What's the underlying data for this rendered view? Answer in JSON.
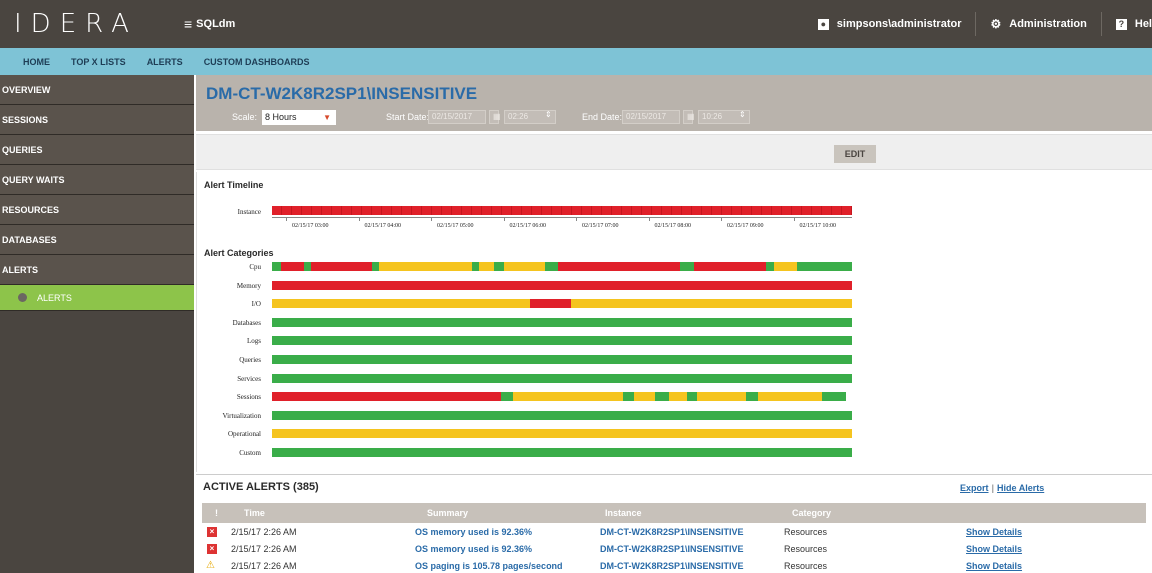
{
  "app": {
    "logo": "IDERA",
    "menu_icon": "≡",
    "name": "SQLdm"
  },
  "topbar": {
    "user": "simpsons\\administrator",
    "admin": "Administration",
    "help": "Hel"
  },
  "nav": [
    "HOME",
    "TOP X LISTS",
    "ALERTS",
    "CUSTOM DASHBOARDS"
  ],
  "sidebar": {
    "items": [
      "OVERVIEW",
      "SESSIONS",
      "QUERIES",
      "QUERY WAITS",
      "RESOURCES",
      "DATABASES",
      "ALERTS"
    ],
    "sub_item": "ALERTS"
  },
  "header": {
    "instance": "DM-CT-W2K8R2SP1\\INSENSITIVE",
    "scale_label": "Scale:",
    "scale_value": "8 Hours",
    "start_label": "Start Date:",
    "start_date": "02/15/2017",
    "start_time": "02:26",
    "end_label": "End Date:",
    "end_date": "02/15/2017",
    "end_time": "10:26"
  },
  "edit_label": "EDIT",
  "timeline": {
    "title": "Alert Timeline",
    "row_label": "Instance",
    "ticks": [
      "02/15/17 03:00",
      "02/15/17 04:00",
      "02/15/17 05:00",
      "02/15/17 06:00",
      "02/15/17 07:00",
      "02/15/17 08:00",
      "02/15/17 09:00",
      "02/15/17 10:00"
    ]
  },
  "categories": {
    "title": "Alert Categories",
    "rows": [
      {
        "label": "Cpu",
        "segments": [
          [
            "g",
            1.5
          ],
          [
            "r",
            4
          ],
          [
            "g",
            1.2
          ],
          [
            "r",
            10.5
          ],
          [
            "g",
            1.3
          ],
          [
            "y",
            16
          ],
          [
            "g",
            1.2
          ],
          [
            "y",
            2.5
          ],
          [
            "g",
            1.8
          ],
          [
            "y",
            7
          ],
          [
            "g",
            2.3
          ],
          [
            "r",
            21
          ],
          [
            "g",
            2.4
          ],
          [
            "r",
            12.5
          ],
          [
            "g",
            1.3
          ],
          [
            "y",
            4
          ],
          [
            "g",
            9.5
          ]
        ]
      },
      {
        "label": "Memory",
        "segments": [
          [
            "r",
            100
          ]
        ]
      },
      {
        "label": "I/O",
        "segments": [
          [
            "y",
            44.5
          ],
          [
            "r",
            7
          ],
          [
            "y",
            48.5
          ]
        ]
      },
      {
        "label": "Databases",
        "segments": [
          [
            "g",
            100
          ]
        ]
      },
      {
        "label": "Logs",
        "segments": [
          [
            "g",
            100
          ]
        ]
      },
      {
        "label": "Queries",
        "segments": [
          [
            "g",
            100
          ]
        ]
      },
      {
        "label": "Services",
        "segments": [
          [
            "g",
            100
          ]
        ]
      },
      {
        "label": "Sessions",
        "segments": [
          [
            "r",
            39.5
          ],
          [
            "g",
            2
          ],
          [
            "y",
            19
          ],
          [
            "g",
            2
          ],
          [
            "y",
            3.5
          ],
          [
            "g",
            2.5
          ],
          [
            "y",
            3
          ],
          [
            "g",
            1.8
          ],
          [
            "y",
            8.5
          ],
          [
            "g",
            2
          ],
          [
            "y",
            11
          ],
          [
            "g",
            4.2
          ]
        ]
      },
      {
        "label": "Virtualization",
        "segments": [
          [
            "g",
            100
          ]
        ]
      },
      {
        "label": "Operational",
        "segments": [
          [
            "y",
            100
          ]
        ]
      },
      {
        "label": "Custom",
        "segments": [
          [
            "g",
            100
          ]
        ]
      }
    ]
  },
  "colors": {
    "g": "#3aad49",
    "r": "#e0202a",
    "y": "#f5c41f",
    "accent": "#2a6ba8",
    "active_nav": "#8dc44a"
  },
  "alerts": {
    "title": "ACTIVE ALERTS (385)",
    "export": "Export",
    "hide": "Hide Alerts",
    "columns": [
      "!",
      "Time",
      "Summary",
      "Instance",
      "Category"
    ],
    "rows": [
      {
        "severity": "critical",
        "time": "2/15/17 2:26 AM",
        "summary": "OS memory used is 92.36%",
        "instance": "DM-CT-W2K8R2SP1\\INSENSITIVE",
        "category": "Resources",
        "action": "Show Details"
      },
      {
        "severity": "critical",
        "time": "2/15/17 2:26 AM",
        "summary": "OS memory used is 92.36%",
        "instance": "DM-CT-W2K8R2SP1\\INSENSITIVE",
        "category": "Resources",
        "action": "Show Details"
      },
      {
        "severity": "warning",
        "time": "2/15/17 2:26 AM",
        "summary": "OS paging is 105.78 pages/second",
        "instance": "DM-CT-W2K8R2SP1\\INSENSITIVE",
        "category": "Resources",
        "action": "Show Details"
      }
    ]
  }
}
